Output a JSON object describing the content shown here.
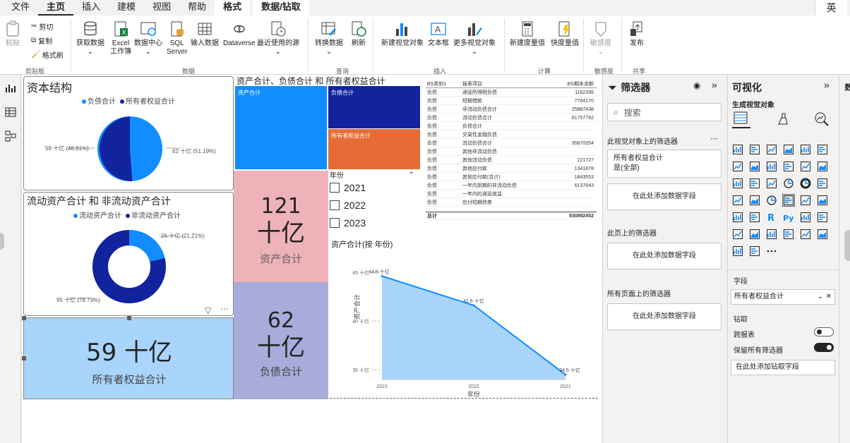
{
  "menu": {
    "items": [
      "文件",
      "主页",
      "插入",
      "建模",
      "视图",
      "帮助",
      "格式",
      "数据/钻取"
    ],
    "active": "主页",
    "ime": "英"
  },
  "ribbon": {
    "clipboard": {
      "paste": "粘贴",
      "cut": "剪切",
      "copy": "复制",
      "format_painter": "格式刷",
      "group": "剪贴板"
    },
    "data": {
      "get_data": "获取数据",
      "excel": "Excel\n工作簿",
      "datahub": "数据中心",
      "sql": "SQL\nServer",
      "enter_data": "输入数据",
      "dataverse": "Dataverse",
      "recent": "最近使用的源",
      "group": "数据"
    },
    "query": {
      "transform": "转换数据",
      "refresh": "刷新",
      "group": "查询"
    },
    "insert": {
      "new_visual": "新建视觉对象",
      "textbox": "文本框",
      "more_visuals": "更多视觉对象",
      "group": "插入"
    },
    "calc": {
      "new_measure": "新建度量值",
      "quick_measure": "快度量值",
      "group": "计算"
    },
    "sensitivity": {
      "label": "敏感度",
      "group": "敏感度"
    },
    "share": {
      "publish": "发布",
      "group": "共享"
    }
  },
  "canvas": {
    "pie1": {
      "title": "资本结构",
      "legend": [
        "负债合计",
        "所有者权益合计"
      ],
      "label_left": "59 十亿 (48.81%)",
      "label_right": "62 十亿 (51.19%)"
    },
    "donut": {
      "title": "流动资产合计 和 非流动资产合计",
      "legend": [
        "流动资产合计",
        "非流动资产合计"
      ],
      "label_top": "26 十亿 (21.21%)",
      "label_bottom": "95 十亿 (78.79%)"
    },
    "kpi_equity": {
      "value": "59 十亿",
      "caption": "所有者权益合计"
    },
    "kpi_assets": {
      "value_num": "121",
      "value_unit": "十亿",
      "caption": "资产合计"
    },
    "kpi_liab": {
      "value_num": "62",
      "value_unit": "十亿",
      "caption": "负债合计"
    },
    "treemap": {
      "title": "资产合计、负债合计 和 所有者权益合计",
      "labels": [
        "资产合计",
        "负债合计",
        "所有者权益合计"
      ]
    },
    "table": {
      "headers": [
        "BS类别1",
        "报表项目",
        "BS期末余额"
      ],
      "rows": [
        [
          "负债",
          "递延所得税负债",
          "1162336"
        ],
        [
          "负债",
          "短期借款",
          "7704170"
        ],
        [
          "负债",
          "非流动负债合计",
          "25887438"
        ],
        [
          "负债",
          "流动负债合计",
          "61757792"
        ],
        [
          "负债",
          "负债合计",
          ""
        ],
        [
          "负债",
          "交易性金融负债",
          ""
        ],
        [
          "负债",
          "流动负债合计",
          "35870354"
        ],
        [
          "负债",
          "其他非流动负债",
          ""
        ],
        [
          "负债",
          "其他流动负债",
          "221727"
        ],
        [
          "负债",
          "其他应付款",
          "1341878"
        ],
        [
          "负债",
          "其他应付款(合计)",
          "1843553"
        ],
        [
          "负债",
          "一年内到期的非流动负债",
          "6137643"
        ],
        [
          "负债",
          "一年内的递延收益",
          ""
        ],
        [
          "负债",
          "应付短期债券",
          ""
        ]
      ],
      "total_label": "总计",
      "total_value": "930892452"
    },
    "slicer": {
      "title": "年份",
      "options": [
        "2021",
        "2022",
        "2023"
      ]
    },
    "area": {
      "title": "资产合计(按 年份)",
      "xlabel": "年份",
      "ylabel": "资产合计",
      "yticks": [
        "45 十亿",
        "40 十亿",
        "35 十亿"
      ],
      "point_labels": [
        "44.6 十亿",
        "41.6 十亿",
        "34.5 十亿"
      ]
    }
  },
  "chart_data": {
    "type": "area",
    "title": "资产合计(按 年份)",
    "xlabel": "年份",
    "ylabel": "资产合计",
    "categories": [
      "2023",
      "2022",
      "2021"
    ],
    "series": [
      {
        "name": "资产合计",
        "values": [
          44.6,
          41.6,
          34.5
        ]
      }
    ],
    "ylim": [
      34,
      46
    ]
  },
  "filters": {
    "title": "筛选器",
    "search_placeholder": "搜索",
    "on_visual": "此视觉对象上的筛选器",
    "filter_card_field": "所有者权益合计",
    "filter_card_value": "是(全部)",
    "add_field": "在此处添加数据字段",
    "on_page": "此页上的筛选器",
    "on_all_pages": "所有页面上的筛选器"
  },
  "viz": {
    "title": "可视化",
    "build": "生成视觉对象",
    "fields_label": "字段",
    "field_value": "所有者权益合计",
    "drill": "钻取",
    "cross_report": "跨报表",
    "keep_filters": "保留所有筛选器",
    "add_drill": "在此处添加钻取字段",
    "colors": {
      "accent": "#118dff",
      "dark": "#12239e",
      "orange": "#e66c37"
    }
  }
}
